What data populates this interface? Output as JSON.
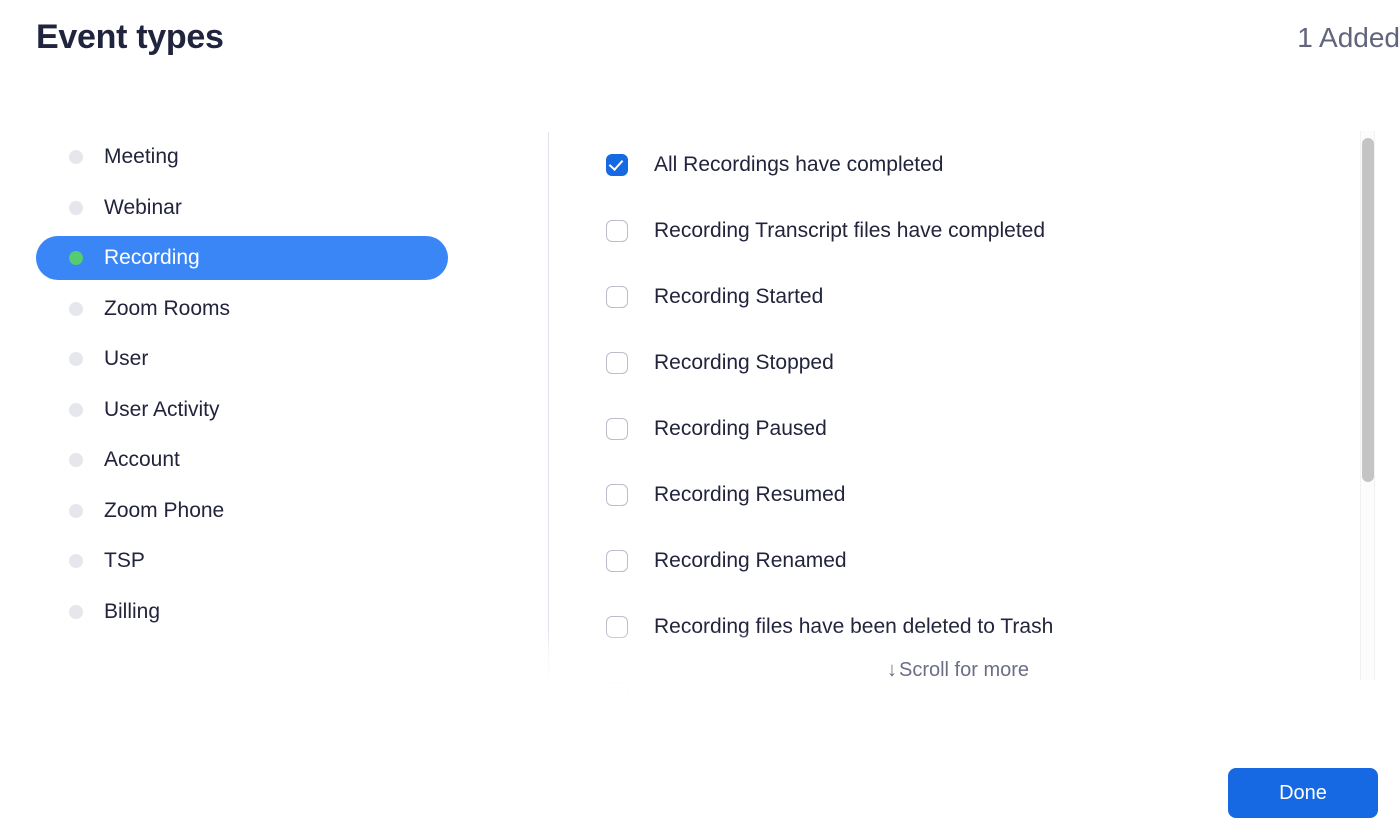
{
  "header": {
    "title": "Event types",
    "added_status": "1 Added"
  },
  "colors": {
    "accent_blue": "#1668e3",
    "selected_pill_blue": "#3b86f7",
    "active_dot_green": "#54cc6f",
    "inactive_dot_gray": "#e6e6ed",
    "title_text": "#21243d",
    "muted_text": "#61647b",
    "divider": "#e3e2ee",
    "scrollbar_thumb": "#c4c4c4"
  },
  "sidebar": {
    "items": [
      {
        "label": "Meeting",
        "selected": false,
        "dot": "status-dot-icon"
      },
      {
        "label": "Webinar",
        "selected": false,
        "dot": "status-dot-icon"
      },
      {
        "label": "Recording",
        "selected": true,
        "dot": "status-dot-icon"
      },
      {
        "label": "Zoom Rooms",
        "selected": false,
        "dot": "status-dot-icon"
      },
      {
        "label": "User",
        "selected": false,
        "dot": "status-dot-icon"
      },
      {
        "label": "User Activity",
        "selected": false,
        "dot": "status-dot-icon"
      },
      {
        "label": "Account",
        "selected": false,
        "dot": "status-dot-icon"
      },
      {
        "label": "Zoom Phone",
        "selected": false,
        "dot": "status-dot-icon"
      },
      {
        "label": "TSP",
        "selected": false,
        "dot": "status-dot-icon"
      },
      {
        "label": "Billing",
        "selected": false,
        "dot": "status-dot-icon"
      }
    ]
  },
  "events": {
    "items": [
      {
        "label": "All Recordings have completed",
        "checked": true
      },
      {
        "label": "Recording Transcript files have completed",
        "checked": false
      },
      {
        "label": "Recording Started",
        "checked": false
      },
      {
        "label": "Recording Stopped",
        "checked": false
      },
      {
        "label": "Recording Paused",
        "checked": false
      },
      {
        "label": "Recording Resumed",
        "checked": false
      },
      {
        "label": "Recording Renamed",
        "checked": false
      },
      {
        "label": "Recording files have been deleted to Trash",
        "checked": false
      },
      {
        "label": "",
        "checked": false
      }
    ],
    "scroll_hint_arrow": "↓",
    "scroll_hint_text": "Scroll for more"
  },
  "footer": {
    "done_label": "Done"
  }
}
